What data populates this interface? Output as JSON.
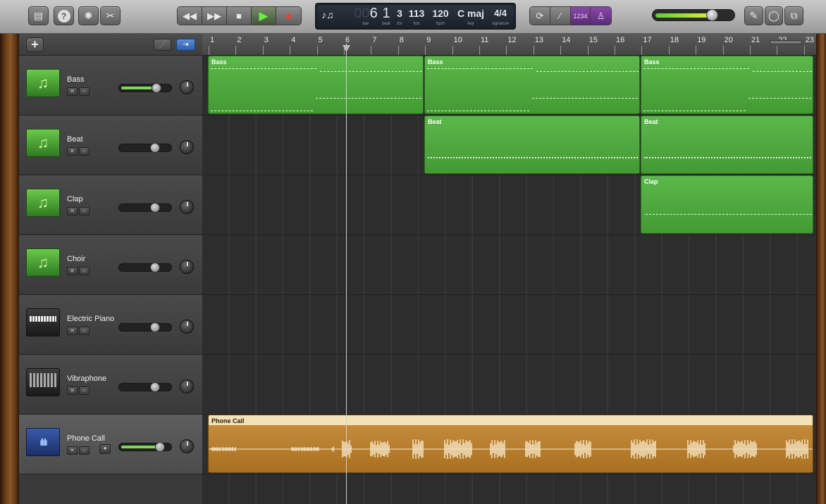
{
  "toolbar": {
    "lcd": {
      "bar": "6",
      "bar_ghost": "00",
      "beat": "1",
      "div": "3",
      "tick": "113",
      "bpm": "120",
      "key": "C maj",
      "signature": "4/4",
      "labels": {
        "bar": "bar",
        "beat": "beat",
        "div": "div",
        "tick": "tick",
        "bpm": "bpm",
        "key": "key",
        "signature": "signature"
      }
    },
    "count_in_label": "1234",
    "master_volume": 0.72,
    "accent_green": "#66ee44",
    "record_color": "#ff3b30"
  },
  "ruler": {
    "bars": [
      "1",
      "2",
      "3",
      "4",
      "5",
      "6",
      "7",
      "8",
      "9",
      "10",
      "11",
      "12",
      "13",
      "14",
      "15",
      "16",
      "17",
      "18",
      "19",
      "20",
      "21",
      "22",
      "23"
    ]
  },
  "tracks": [
    {
      "name": "Bass",
      "icon": "music-note-icon",
      "volume": 0.72,
      "selected": false
    },
    {
      "name": "Beat",
      "icon": "music-note-icon",
      "volume": 0.68,
      "selected": false
    },
    {
      "name": "Clap",
      "icon": "music-note-icon",
      "volume": 0.68,
      "selected": false
    },
    {
      "name": "Choir",
      "icon": "music-note-icon",
      "volume": 0.68,
      "selected": false
    },
    {
      "name": "Electric Piano",
      "icon": "electric-piano-icon",
      "volume": 0.68,
      "selected": false
    },
    {
      "name": "Vibraphone",
      "icon": "vibraphone-icon",
      "volume": 0.68,
      "selected": false
    },
    {
      "name": "Phone Call",
      "icon": "audio-waveform-icon",
      "volume": 0.78,
      "selected": true
    }
  ],
  "regions": {
    "bass": [
      "Bass",
      "Bass",
      "Bass"
    ],
    "beat": [
      "Beat",
      "Beat"
    ],
    "clap": [
      "Clap"
    ],
    "phone": [
      "Phone Call"
    ]
  }
}
